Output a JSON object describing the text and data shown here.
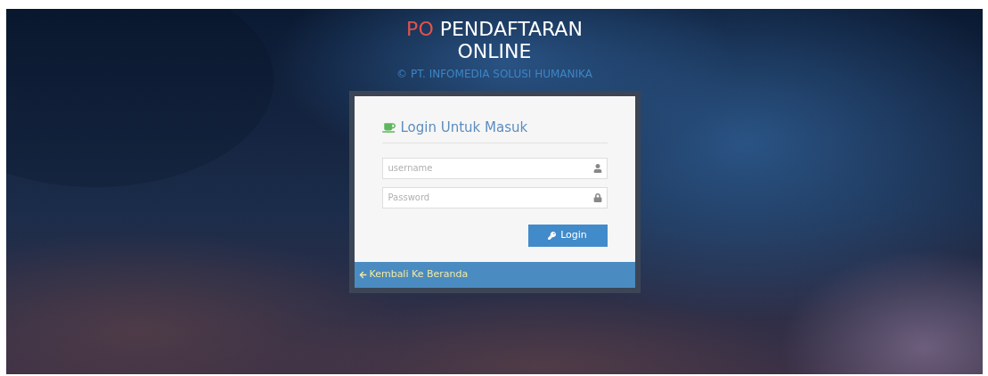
{
  "header": {
    "accent": "PO",
    "title": "PENDAFTARAN ONLINE",
    "copyright": "© PT. INFOMEDIA SOLUSI HUMANIKA"
  },
  "login": {
    "heading": "Login Untuk Masuk",
    "fields": [
      {
        "kind": "text",
        "placeholder": "username"
      },
      {
        "kind": "password",
        "placeholder": "Password"
      }
    ],
    "button": "Login",
    "back_link": "Kembali Ke Beranda"
  }
}
